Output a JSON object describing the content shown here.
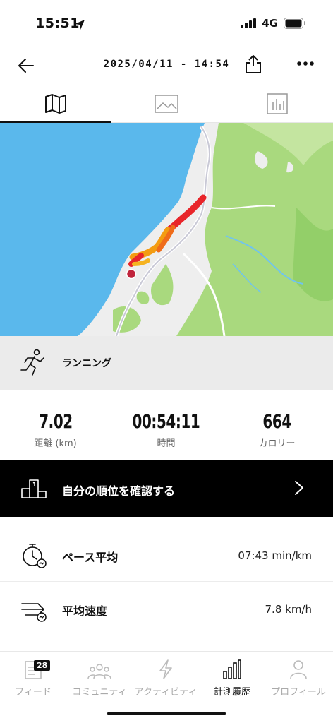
{
  "status": {
    "time": "15:51",
    "network": "4G"
  },
  "nav": {
    "title": "2025/04/11 - 14:54"
  },
  "tabs": [
    {
      "name": "map",
      "icon": "map-icon"
    },
    {
      "name": "photos",
      "icon": "image-icon"
    },
    {
      "name": "stats",
      "icon": "bar-chart-icon"
    }
  ],
  "activity": {
    "type": "ランニング"
  },
  "stats": {
    "distance": {
      "value": "7.02",
      "label": "距離 (km)"
    },
    "time": {
      "value": "00:54:11",
      "label": "時間"
    },
    "calories": {
      "value": "664",
      "label": "カロリー"
    }
  },
  "ranking": {
    "label": "自分の順位を確認する"
  },
  "metrics": [
    {
      "label": "ペース平均",
      "value": "07:43 min/km"
    },
    {
      "label": "平均速度",
      "value": "7.8 km/h"
    }
  ],
  "bottom_nav": {
    "feed": {
      "label": "フィード",
      "badge": "28"
    },
    "community": {
      "label": "コミュニティ"
    },
    "activity": {
      "label": "アクティビティ"
    },
    "history": {
      "label": "計測履歴"
    },
    "profile": {
      "label": "プロフィール"
    }
  },
  "colors": {
    "sea": "#5ab8ec",
    "land": "#eeeeee",
    "forest": "#a9d97e",
    "route_hot": "#e8252a",
    "route_warm": "#f39c12"
  }
}
